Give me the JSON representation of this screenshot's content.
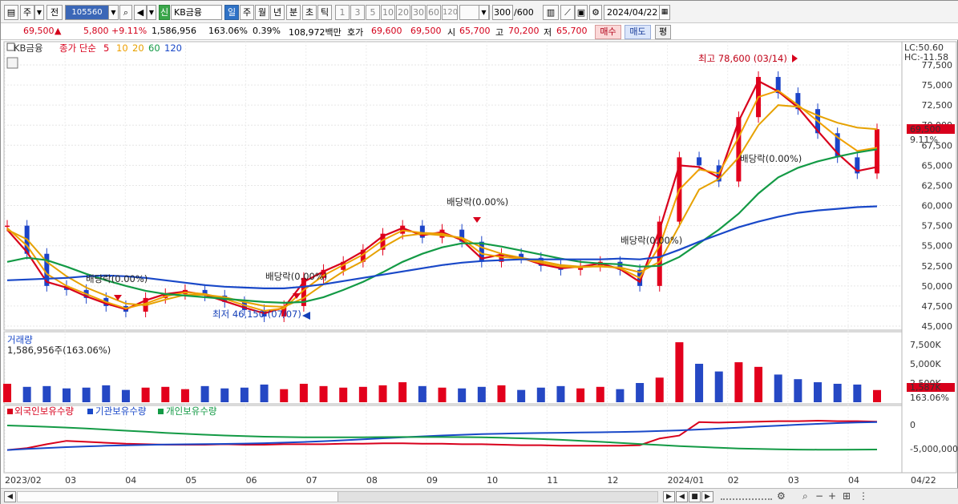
{
  "toolbar": {
    "market_label": "주",
    "prev_label": "전",
    "code_value": "105560",
    "badge_new": "신",
    "stock_name": "KB금융",
    "periods": [
      "일",
      "주",
      "월",
      "년",
      "분",
      "초",
      "틱"
    ],
    "intervals": [
      "1",
      "3",
      "5",
      "10",
      "20",
      "30",
      "60",
      "120"
    ],
    "count_value": "300",
    "count_total": "/600",
    "date_value": "2024/04/22"
  },
  "quote": {
    "price": "69,500",
    "change": "5,800",
    "change_pct": "+9.11%",
    "volume": "1,586,956",
    "volume_ratio": "163.06%",
    "turnover": "0.39%",
    "amount": "108,972백만",
    "ask_label": "호가",
    "ask1": "69,600",
    "ask2": "69,500",
    "open_label": "시",
    "open": "65,700",
    "high_label": "고",
    "high": "70,200",
    "low_label": "저",
    "low": "65,700",
    "buy_label": "매수",
    "sell_label": "매도",
    "avg_label": "평"
  },
  "legend": {
    "name": "KB금융",
    "close_label": "종가 단순",
    "ma": [
      "5",
      "10",
      "20",
      "60",
      "120"
    ],
    "colors": {
      "price": "#d8001c",
      "ma5": "#d8001c",
      "ma10": "#f0a000",
      "ma20": "#e6a100",
      "ma60": "#139a45",
      "ma120": "#1948c8"
    }
  },
  "annotations": {
    "high": "최고 78,600 (03/14)",
    "low": "최저 46,150 (07/07)",
    "div1": "배당락(0.00%)",
    "div2": "배당락(0.00%)",
    "div3": "배당락(0.00%)",
    "div4": "배당락(0.00%)",
    "div5": "배당락(0.00%)",
    "lc": "LC:50.60",
    "hc": "HC:-11.58",
    "price_tag": "69,500",
    "pct_tag": "9.11%"
  },
  "volume_panel": {
    "title": "거래량",
    "value": "1,586,956주(163.06%)",
    "axis": [
      "7,500K",
      "5,000K",
      "2,500K"
    ],
    "tag": "1,587K",
    "tag_pct": "163.06%"
  },
  "holding_panel": {
    "items": [
      "외국인보유수량",
      "기관보유수량",
      "개인보유수량"
    ],
    "axis": [
      "0",
      "-5,000,000"
    ]
  },
  "chart_data": {
    "type": "candlestick",
    "title": "KB금융",
    "y_axis": [
      "77,500",
      "75,000",
      "72,500",
      "70,000",
      "67,500",
      "65,000",
      "62,500",
      "60,000",
      "57,500",
      "55,000",
      "52,500",
      "50,000",
      "47,500",
      "45,000"
    ],
    "ylim": [
      45000,
      78600
    ],
    "x_labels": [
      "2023/02",
      "03",
      "04",
      "05",
      "06",
      "07",
      "08",
      "09",
      "10",
      "11",
      "12",
      "2024/01",
      "02",
      "03",
      "04",
      "04/22"
    ],
    "series": [
      {
        "name": "종가",
        "values": [
          57500,
          54000,
          50000,
          49500,
          48500,
          47500,
          46800,
          48500,
          49000,
          49500,
          48800,
          48000,
          47000,
          46200,
          47500,
          51000,
          52000,
          53000,
          54500,
          56500,
          57500,
          56000,
          57000,
          55500,
          53000,
          54000,
          53500,
          52500,
          52000,
          52500,
          53000,
          52000,
          50000,
          58000,
          66000,
          65000,
          63000,
          71000,
          76000,
          74000,
          72000,
          69000,
          66000,
          64000,
          69500
        ]
      },
      {
        "name": "5",
        "values": [
          57000,
          54200,
          50500,
          49800,
          48700,
          47800,
          47100,
          48200,
          49000,
          49300,
          48900,
          48100,
          47300,
          46600,
          47300,
          50500,
          51800,
          52900,
          54300,
          56200,
          57200,
          56300,
          56700,
          55700,
          53400,
          53900,
          53500,
          52700,
          52200,
          52400,
          52800,
          52100,
          50500,
          57000,
          65000,
          64800,
          63500,
          70500,
          75500,
          74200,
          72200,
          69300,
          66500,
          64300,
          64800
        ]
      },
      {
        "name": "10",
        "values": [
          57200,
          55000,
          51500,
          50000,
          49000,
          48000,
          47200,
          47800,
          48700,
          49200,
          49000,
          48400,
          47600,
          46900,
          47200,
          49500,
          51300,
          52600,
          53900,
          55700,
          56900,
          56600,
          56500,
          55900,
          54000,
          53600,
          53400,
          52900,
          52400,
          52300,
          52500,
          52200,
          51000,
          55000,
          62000,
          64500,
          64000,
          68500,
          73500,
          74300,
          72500,
          70500,
          68500,
          66800,
          67200
        ]
      },
      {
        "name": "20",
        "values": [
          57000,
          55800,
          53000,
          51200,
          49800,
          48800,
          47800,
          47600,
          48300,
          48900,
          48900,
          48600,
          48000,
          47500,
          47400,
          48500,
          50200,
          51800,
          53100,
          54800,
          56200,
          56500,
          56300,
          56000,
          54800,
          54000,
          53500,
          53100,
          52600,
          52400,
          52400,
          52300,
          51700,
          53000,
          57500,
          62000,
          63300,
          66000,
          70000,
          72500,
          72300,
          71200,
          70300,
          69700,
          69500
        ]
      },
      {
        "name": "60",
        "values": [
          53000,
          53500,
          53200,
          52400,
          51500,
          50700,
          50000,
          49400,
          49000,
          48800,
          48600,
          48400,
          48200,
          48000,
          47900,
          48000,
          48600,
          49500,
          50500,
          51700,
          53000,
          54000,
          54800,
          55300,
          55300,
          54900,
          54400,
          53900,
          53400,
          53000,
          52800,
          52700,
          52400,
          52500,
          53600,
          55300,
          57000,
          59000,
          61500,
          63500,
          64700,
          65500,
          66100,
          66600,
          67000
        ]
      },
      {
        "name": "120",
        "values": [
          50700,
          50800,
          50900,
          51000,
          51200,
          51300,
          51200,
          51000,
          50700,
          50400,
          50100,
          49900,
          49800,
          49700,
          49700,
          49900,
          50200,
          50600,
          51000,
          51400,
          51800,
          52200,
          52600,
          52900,
          53100,
          53200,
          53300,
          53300,
          53300,
          53300,
          53300,
          53400,
          53300,
          53600,
          54500,
          55500,
          56400,
          57300,
          58000,
          58600,
          59100,
          59400,
          59600,
          59800,
          59900
        ]
      }
    ],
    "volume": [
      2.4,
      2.0,
      2.1,
      1.8,
      1.9,
      2.2,
      1.6,
      1.9,
      2.0,
      1.7,
      2.1,
      1.8,
      1.9,
      2.3,
      1.7,
      2.4,
      2.1,
      1.9,
      2.0,
      2.2,
      2.6,
      2.1,
      1.9,
      1.8,
      2.0,
      2.2,
      1.6,
      1.9,
      2.1,
      1.8,
      2.0,
      1.7,
      2.5,
      3.2,
      7.8,
      5.0,
      4.0,
      5.2,
      4.6,
      3.6,
      3.0,
      2.6,
      2.4,
      2.3,
      1.587
    ],
    "foreign": [
      -5600000,
      -5200000,
      -4400000,
      -3700000,
      -3900000,
      -4100000,
      -4300000,
      -4400000,
      -4500000,
      -4500000,
      -4500000,
      -4400000,
      -4500000,
      -4500000,
      -4400000,
      -4400000,
      -4400000,
      -4300000,
      -4300000,
      -4200000,
      -4200000,
      -4300000,
      -4300000,
      -4400000,
      -4400000,
      -4500000,
      -4600000,
      -4600000,
      -4700000,
      -4700000,
      -4700000,
      -4700000,
      -4600000,
      -3200000,
      -2600000,
      200000,
      100000,
      200000,
      300000,
      400000,
      400000,
      500000,
      400000,
      400000,
      300000
    ]
  }
}
